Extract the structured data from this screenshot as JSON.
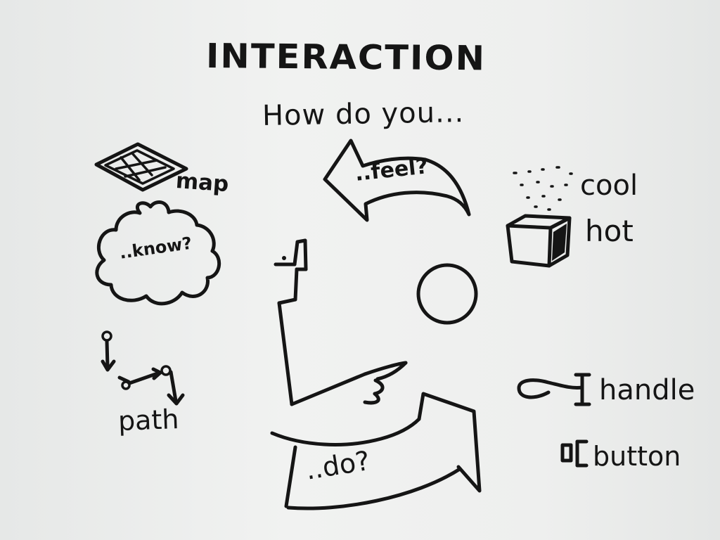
{
  "title": "INTERACTION",
  "subtitle": "How do you...",
  "arrows": {
    "top": "..feel?",
    "bottom": "..do?"
  },
  "left_column": {
    "thought": "..know?",
    "map": "map",
    "path": "path"
  },
  "right_column": {
    "cool": "cool",
    "hot": "hot",
    "handle": "handle",
    "button": "button"
  },
  "icons": [
    "map-icon",
    "thought-cloud-icon",
    "path-icon",
    "ice-cube-icon",
    "handle-icon",
    "button-icon",
    "person-profile-icon",
    "ball-icon"
  ],
  "colors": {
    "paper": "#ebedec",
    "ink": "#151515"
  }
}
